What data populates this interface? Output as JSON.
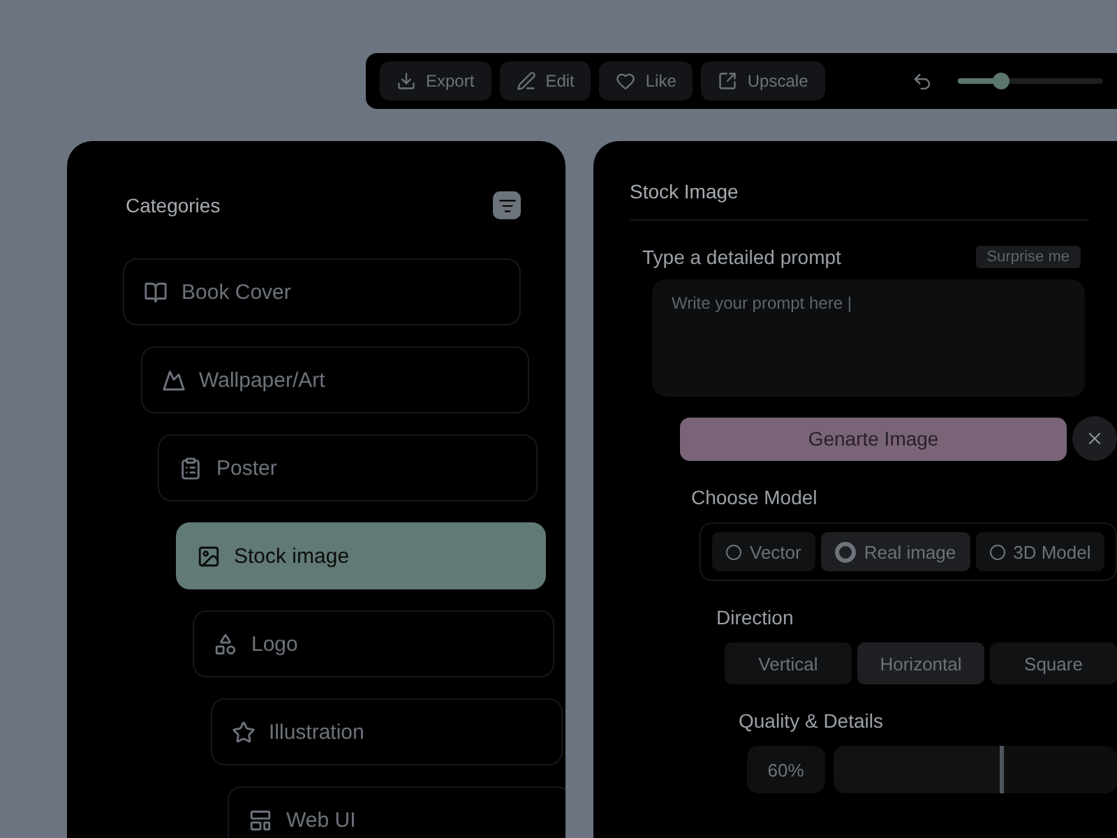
{
  "toolbar": {
    "actions": [
      {
        "label": "Export"
      },
      {
        "label": "Edit"
      },
      {
        "label": "Like"
      },
      {
        "label": "Upscale"
      }
    ],
    "zoom": {
      "level": 0.3
    }
  },
  "categories": {
    "title": "Categories",
    "items": [
      {
        "label": "Book Cover",
        "selected": false
      },
      {
        "label": "Wallpaper/Art",
        "selected": false
      },
      {
        "label": "Poster",
        "selected": false
      },
      {
        "label": "Stock image",
        "selected": true
      },
      {
        "label": "Logo",
        "selected": false
      },
      {
        "label": "Illustration",
        "selected": false
      },
      {
        "label": "Web UI",
        "selected": false
      }
    ]
  },
  "editor": {
    "title": "Stock Image",
    "prompt_label": "Type a detailed prompt",
    "surprise": "Surprise me",
    "prompt": {
      "placeholder": "Write your prompt here |"
    },
    "generate": "Genarte Image",
    "model_label": "Choose Model",
    "models": [
      {
        "label": "Vector",
        "selected": false
      },
      {
        "label": "Real image",
        "selected": true
      },
      {
        "label": "3D Model",
        "selected": false
      }
    ],
    "direction_label": "Direction",
    "directions": [
      {
        "label": "Vertical",
        "selected": false
      },
      {
        "label": "Horizontal",
        "selected": true
      },
      {
        "label": "Square",
        "selected": false
      }
    ],
    "quality_label": "Quality & Details",
    "quality": {
      "reading": "60%",
      "level": 0.6
    }
  }
}
